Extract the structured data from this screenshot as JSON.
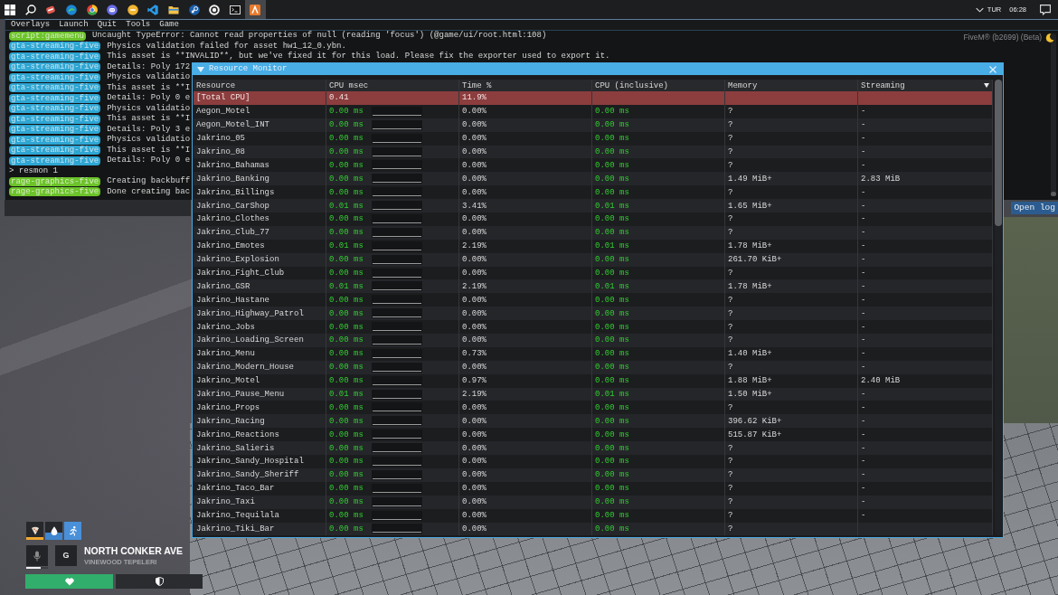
{
  "taskbar": {
    "items": [
      {
        "selected": false
      },
      {
        "selected": false
      },
      {
        "selected": false
      },
      {
        "selected": false
      },
      {
        "selected": false
      },
      {
        "selected": false
      },
      {
        "selected": false
      },
      {
        "selected": false
      },
      {
        "selected": false
      },
      {
        "selected": false
      },
      {
        "selected": false
      },
      {
        "selected": false
      },
      {
        "selected": true
      }
    ],
    "language": "TUR",
    "time": "06:28"
  },
  "menu": [
    "Overlays",
    "Launch",
    "Quit",
    "Tools",
    "Game"
  ],
  "app_label": "FiveM® (b2699) (Beta)",
  "console": {
    "lines": [
      {
        "kind": "log",
        "tag": "script:gamemenu",
        "color": "#6cc32a",
        "text": "Uncaught TypeError: Cannot read properties of null (reading 'focus') (@game/ui/root.html:108)"
      },
      {
        "kind": "log",
        "tag": "gta-streaming-five",
        "color": "#2ea6d3",
        "text": "Physics validation failed for asset hw1_12_0.ybn."
      },
      {
        "kind": "log",
        "tag": "gta-streaming-five",
        "color": "#2ea6d3",
        "text": "This asset is **INVALID**, but we've fixed it for this load. Please fix the exporter used to export it."
      },
      {
        "kind": "log",
        "tag": "gta-streaming-five",
        "color": "#2ea6d3",
        "text": "Details: Poly 172"
      },
      {
        "kind": "log",
        "tag": "gta-streaming-five",
        "color": "#2ea6d3",
        "text": "Physics validatio"
      },
      {
        "kind": "log",
        "tag": "gta-streaming-five",
        "color": "#2ea6d3",
        "text": "This asset is **I"
      },
      {
        "kind": "log",
        "tag": "gta-streaming-five",
        "color": "#2ea6d3",
        "text": "Details: Poly 0 e"
      },
      {
        "kind": "log",
        "tag": "gta-streaming-five",
        "color": "#2ea6d3",
        "text": "Physics validatio"
      },
      {
        "kind": "log",
        "tag": "gta-streaming-five",
        "color": "#2ea6d3",
        "text": "This asset is **I"
      },
      {
        "kind": "log",
        "tag": "gta-streaming-five",
        "color": "#2ea6d3",
        "text": "Details: Poly 3 e"
      },
      {
        "kind": "log",
        "tag": "gta-streaming-five",
        "color": "#2ea6d3",
        "text": "Physics validatio"
      },
      {
        "kind": "log",
        "tag": "gta-streaming-five",
        "color": "#2ea6d3",
        "text": "This asset is **I"
      },
      {
        "kind": "log",
        "tag": "gta-streaming-five",
        "color": "#2ea6d3",
        "text": "Details: Poly 0 e"
      },
      {
        "kind": "command",
        "text": "> resmon 1"
      },
      {
        "kind": "log",
        "tag": "rage-graphics-five",
        "color": "#6cc32a",
        "text": "Creating backbuff"
      },
      {
        "kind": "log",
        "tag": "rage-graphics-five",
        "color": "#6cc32a",
        "text": "Done creating bac"
      }
    ],
    "open_log": "Open log"
  },
  "resource_monitor": {
    "title": "Resource Monitor",
    "columns": [
      "Resource",
      "CPU msec",
      "Time %",
      "CPU (inclusive)",
      "Memory",
      "Streaming"
    ],
    "rows": [
      {
        "kind": "total",
        "resource": "[Total CPU]",
        "cpu": "0.41",
        "time": "11.9%"
      },
      {
        "kind": "resource",
        "resource": "Aegon_Motel",
        "cpu": "0.00 ms",
        "time": "0.00%",
        "cpu_inclusive": "0.00 ms",
        "memory": "?",
        "streaming": "-"
      },
      {
        "kind": "resource",
        "resource": "Aegon_Motel_INT",
        "cpu": "0.00 ms",
        "time": "0.00%",
        "cpu_inclusive": "0.00 ms",
        "memory": "?",
        "streaming": "-"
      },
      {
        "kind": "resource",
        "resource": "Jakrino_05",
        "cpu": "0.00 ms",
        "time": "0.00%",
        "cpu_inclusive": "0.00 ms",
        "memory": "?",
        "streaming": "-"
      },
      {
        "kind": "resource",
        "resource": "Jakrino_08",
        "cpu": "0.00 ms",
        "time": "0.00%",
        "cpu_inclusive": "0.00 ms",
        "memory": "?",
        "streaming": "-"
      },
      {
        "kind": "resource",
        "resource": "Jakrino_Bahamas",
        "cpu": "0.00 ms",
        "time": "0.00%",
        "cpu_inclusive": "0.00 ms",
        "memory": "?",
        "streaming": "-"
      },
      {
        "kind": "resource",
        "resource": "Jakrino_Banking",
        "cpu": "0.00 ms",
        "time": "0.00%",
        "cpu_inclusive": "0.00 ms",
        "memory": "1.49 MiB+",
        "streaming": "2.83 MiB"
      },
      {
        "kind": "resource",
        "resource": "Jakrino_Billings",
        "cpu": "0.00 ms",
        "time": "0.00%",
        "cpu_inclusive": "0.00 ms",
        "memory": "?",
        "streaming": "-"
      },
      {
        "kind": "resource",
        "resource": "Jakrino_CarShop",
        "cpu": "0.01 ms",
        "time": "3.41%",
        "cpu_inclusive": "0.01 ms",
        "memory": "1.65 MiB+",
        "streaming": "-"
      },
      {
        "kind": "resource",
        "resource": "Jakrino_Clothes",
        "cpu": "0.00 ms",
        "time": "0.00%",
        "cpu_inclusive": "0.00 ms",
        "memory": "?",
        "streaming": "-"
      },
      {
        "kind": "resource",
        "resource": "Jakrino_Club_77",
        "cpu": "0.00 ms",
        "time": "0.00%",
        "cpu_inclusive": "0.00 ms",
        "memory": "?",
        "streaming": "-"
      },
      {
        "kind": "resource",
        "resource": "Jakrino_Emotes",
        "cpu": "0.01 ms",
        "time": "2.19%",
        "cpu_inclusive": "0.01 ms",
        "memory": "1.78 MiB+",
        "streaming": "-"
      },
      {
        "kind": "resource",
        "resource": "Jakrino_Explosion",
        "cpu": "0.00 ms",
        "time": "0.00%",
        "cpu_inclusive": "0.00 ms",
        "memory": "261.70 KiB+",
        "streaming": "-"
      },
      {
        "kind": "resource",
        "resource": "Jakrino_Fight_Club",
        "cpu": "0.00 ms",
        "time": "0.00%",
        "cpu_inclusive": "0.00 ms",
        "memory": "?",
        "streaming": "-"
      },
      {
        "kind": "resource",
        "resource": "Jakrino_GSR",
        "cpu": "0.01 ms",
        "time": "2.19%",
        "cpu_inclusive": "0.01 ms",
        "memory": "1.78 MiB+",
        "streaming": "-"
      },
      {
        "kind": "resource",
        "resource": "Jakrino_Hastane",
        "cpu": "0.00 ms",
        "time": "0.00%",
        "cpu_inclusive": "0.00 ms",
        "memory": "?",
        "streaming": "-"
      },
      {
        "kind": "resource",
        "resource": "Jakrino_Highway_Patrol",
        "cpu": "0.00 ms",
        "time": "0.00%",
        "cpu_inclusive": "0.00 ms",
        "memory": "?",
        "streaming": "-"
      },
      {
        "kind": "resource",
        "resource": "Jakrino_Jobs",
        "cpu": "0.00 ms",
        "time": "0.00%",
        "cpu_inclusive": "0.00 ms",
        "memory": "?",
        "streaming": "-"
      },
      {
        "kind": "resource",
        "resource": "Jakrino_Loading_Screen",
        "cpu": "0.00 ms",
        "time": "0.00%",
        "cpu_inclusive": "0.00 ms",
        "memory": "?",
        "streaming": "-"
      },
      {
        "kind": "resource",
        "resource": "Jakrino_Menu",
        "cpu": "0.00 ms",
        "time": "0.73%",
        "cpu_inclusive": "0.00 ms",
        "memory": "1.40 MiB+",
        "streaming": "-"
      },
      {
        "kind": "resource",
        "resource": "Jakrino_Modern_House",
        "cpu": "0.00 ms",
        "time": "0.00%",
        "cpu_inclusive": "0.00 ms",
        "memory": "?",
        "streaming": "-"
      },
      {
        "kind": "resource",
        "resource": "Jakrino_Motel",
        "cpu": "0.00 ms",
        "time": "0.97%",
        "cpu_inclusive": "0.00 ms",
        "memory": "1.88 MiB+",
        "streaming": "2.40 MiB"
      },
      {
        "kind": "resource",
        "resource": "Jakrino_Pause_Menu",
        "cpu": "0.01 ms",
        "time": "2.19%",
        "cpu_inclusive": "0.01 ms",
        "memory": "1.50 MiB+",
        "streaming": "-"
      },
      {
        "kind": "resource",
        "resource": "Jakrino_Props",
        "cpu": "0.00 ms",
        "time": "0.00%",
        "cpu_inclusive": "0.00 ms",
        "memory": "?",
        "streaming": "-"
      },
      {
        "kind": "resource",
        "resource": "Jakrino_Racing",
        "cpu": "0.00 ms",
        "time": "0.00%",
        "cpu_inclusive": "0.00 ms",
        "memory": "396.62 KiB+",
        "streaming": "-"
      },
      {
        "kind": "resource",
        "resource": "Jakrino_Reactions",
        "cpu": "0.00 ms",
        "time": "0.00%",
        "cpu_inclusive": "0.00 ms",
        "memory": "515.87 KiB+",
        "streaming": "-"
      },
      {
        "kind": "resource",
        "resource": "Jakrino_Salieris",
        "cpu": "0.00 ms",
        "time": "0.00%",
        "cpu_inclusive": "0.00 ms",
        "memory": "?",
        "streaming": "-"
      },
      {
        "kind": "resource",
        "resource": "Jakrino_Sandy_Hospital",
        "cpu": "0.00 ms",
        "time": "0.00%",
        "cpu_inclusive": "0.00 ms",
        "memory": "?",
        "streaming": "-"
      },
      {
        "kind": "resource",
        "resource": "Jakrino_Sandy_Sheriff",
        "cpu": "0.00 ms",
        "time": "0.00%",
        "cpu_inclusive": "0.00 ms",
        "memory": "?",
        "streaming": "-"
      },
      {
        "kind": "resource",
        "resource": "Jakrino_Taco_Bar",
        "cpu": "0.00 ms",
        "time": "0.00%",
        "cpu_inclusive": "0.00 ms",
        "memory": "?",
        "streaming": "-"
      },
      {
        "kind": "resource",
        "resource": "Jakrino_Taxi",
        "cpu": "0.00 ms",
        "time": "0.00%",
        "cpu_inclusive": "0.00 ms",
        "memory": "?",
        "streaming": "-"
      },
      {
        "kind": "resource",
        "resource": "Jakrino_Tequilala",
        "cpu": "0.00 ms",
        "time": "0.00%",
        "cpu_inclusive": "0.00 ms",
        "memory": "?",
        "streaming": "-"
      },
      {
        "kind": "resource",
        "resource": "Jakrino_Tiki_Bar",
        "cpu": "0.00 ms",
        "time": "0.00%",
        "cpu_inclusive": "0.00 ms",
        "memory": "?"
      }
    ]
  },
  "hud": {
    "statuses": [
      {
        "kind": "hunger",
        "level": 0.15,
        "color": "#f0a830"
      },
      {
        "kind": "thirst",
        "level": 0.42,
        "color": "#3f86cf"
      },
      {
        "kind": "stamina",
        "level": 1,
        "color": "#4a90d9"
      }
    ],
    "voice": {
      "level": 0.65
    },
    "key": "G",
    "street": "NORTH CONKER AVE",
    "area": "VINEWOOD TEPELERI",
    "health": {
      "level": 1
    }
  }
}
